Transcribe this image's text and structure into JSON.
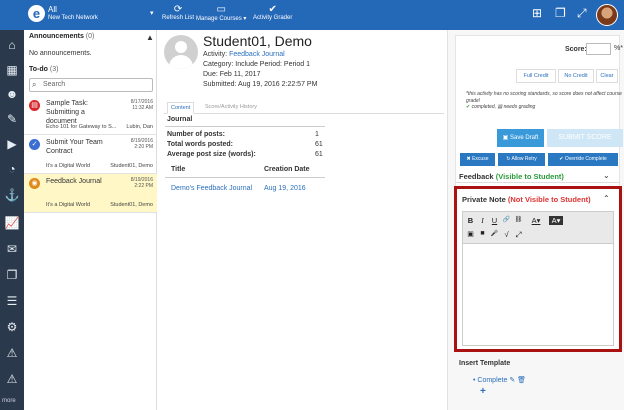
{
  "topbar": {
    "logo_letter": "e",
    "network_all": "All",
    "network_name": "New Tech Network",
    "refresh_label": "Refresh List",
    "manage_courses_label": "Manage Courses ▾",
    "activity_grader_label": "Activity Grader",
    "icons": [
      "plus-square-icon",
      "copy-icon",
      "expand-icon",
      "user-avatar"
    ]
  },
  "rail": {
    "icons": [
      "home-icon",
      "calendar-icon",
      "users-icon",
      "edit-icon",
      "play-icon",
      "dashboard-icon",
      "anchor-icon",
      "chart-icon",
      "mail-icon",
      "copy-icon",
      "list-icon",
      "cogs-icon",
      "warning-icon",
      "warning-icon"
    ],
    "more_label": "more"
  },
  "sidebar": {
    "announcements_title": "Announcements",
    "announcements_count": "(0)",
    "no_announcements": "No announcements.",
    "todo_title": "To-do",
    "todo_count": "(3)",
    "search_placeholder": "Search",
    "todos": [
      {
        "title": "Sample Task: Submitting a document",
        "date": "8/17/2016",
        "time": "11:32 AM",
        "course": "Echo 101 for Gateway to S...",
        "student": "Lubin, Dan",
        "icon_color": "#d9262c",
        "icon": "task-icon"
      },
      {
        "title": "Submit Your Team Contract",
        "date": "8/19/2016",
        "time": "2:20 PM",
        "course": "It's a Digital World",
        "student": "Student01, Demo",
        "icon_color": "#3a6fd1",
        "icon": "check-icon"
      },
      {
        "title": "Feedback Journal",
        "date": "8/19/2016",
        "time": "2:22 PM",
        "course": "It's a Digital World",
        "student": "Student01, Demo",
        "icon_color": "#e08a1a",
        "icon": "journal-icon"
      }
    ]
  },
  "main": {
    "student_name": "Student01, Demo",
    "activity_label": "Activity:",
    "activity_link": "Feedback Journal",
    "category_line": "Category: Include   Period: Period 1",
    "due_line": "Due: Feb 11, 2017",
    "submitted_line": "Submitted: Aug 19, 2016 2:22:57 PM",
    "tabs": [
      "Content",
      "Score/Activity History"
    ],
    "journal_title": "Journal",
    "stats": [
      {
        "label": "Number of posts:",
        "value": "1"
      },
      {
        "label": "Total words posted:",
        "value": "61"
      },
      {
        "label": "Average post size (words):",
        "value": "61"
      }
    ],
    "table_headers": [
      "Title",
      "Creation Date"
    ],
    "row": {
      "title": "Demo's Feedback Journal",
      "date": "Aug 19, 2016"
    }
  },
  "grader": {
    "score_label": "Score:",
    "score_value": "",
    "score_suffix": "%*",
    "full_credit": "Full Credit",
    "no_credit": "No Credit",
    "clear": "Clear",
    "note_line1": "*this activity has no scoring standards, so score does not affect course grade!",
    "note_completed": "completed,",
    "note_needs_grading": "needs grading",
    "save_draft": "Save Draft",
    "submit_score": "SUBMIT SCORE",
    "excuse": "Excuse",
    "allow_retry": "Allow Retry",
    "override_complete": "Override Complete",
    "feedback_label": "Feedback",
    "feedback_visibility": "(Visible to Student)",
    "private_note_label": "Private Note",
    "private_note_visibility": "(Not Visible to Student)",
    "editor_tools_row1": [
      "B",
      "I",
      "U",
      "🔗",
      "⛓",
      "A▾",
      "A▾"
    ],
    "editor_tools_row2": [
      "▣",
      "■",
      "🎤",
      "√",
      "⤢"
    ],
    "insert_template_title": "Insert Template",
    "template_item": "Complete",
    "add_label": "+"
  }
}
